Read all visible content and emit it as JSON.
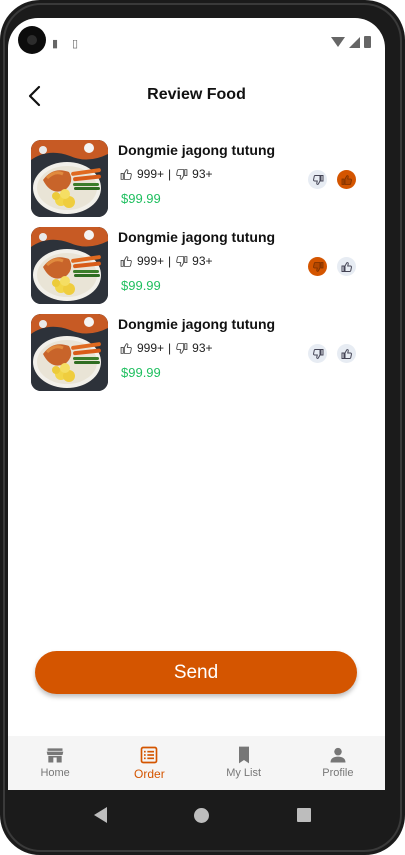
{
  "header": {
    "title": "Review Food"
  },
  "colors": {
    "accent": "#d45500",
    "price": "#1fbf5f",
    "inactive_rate_bg": "#e7ecf3"
  },
  "items": [
    {
      "name": "Dongmie jagong tutung",
      "likes": "999+",
      "separator": "|",
      "dislikes": "93+",
      "price": "$99.99",
      "selected": "like"
    },
    {
      "name": "Dongmie jagong tutung",
      "likes": "999+",
      "separator": "|",
      "dislikes": "93+",
      "price": "$99.99",
      "selected": "dislike"
    },
    {
      "name": "Dongmie jagong tutung",
      "likes": "999+",
      "separator": "|",
      "dislikes": "93+",
      "price": "$99.99",
      "selected": "none"
    }
  ],
  "send_label": "Send",
  "nav": [
    {
      "label": "Home",
      "icon": "store-icon",
      "active": false
    },
    {
      "label": "Order",
      "icon": "order-list-icon",
      "active": true
    },
    {
      "label": "My List",
      "icon": "bookmark-icon",
      "active": false
    },
    {
      "label": "Profile",
      "icon": "person-icon",
      "active": false
    }
  ]
}
